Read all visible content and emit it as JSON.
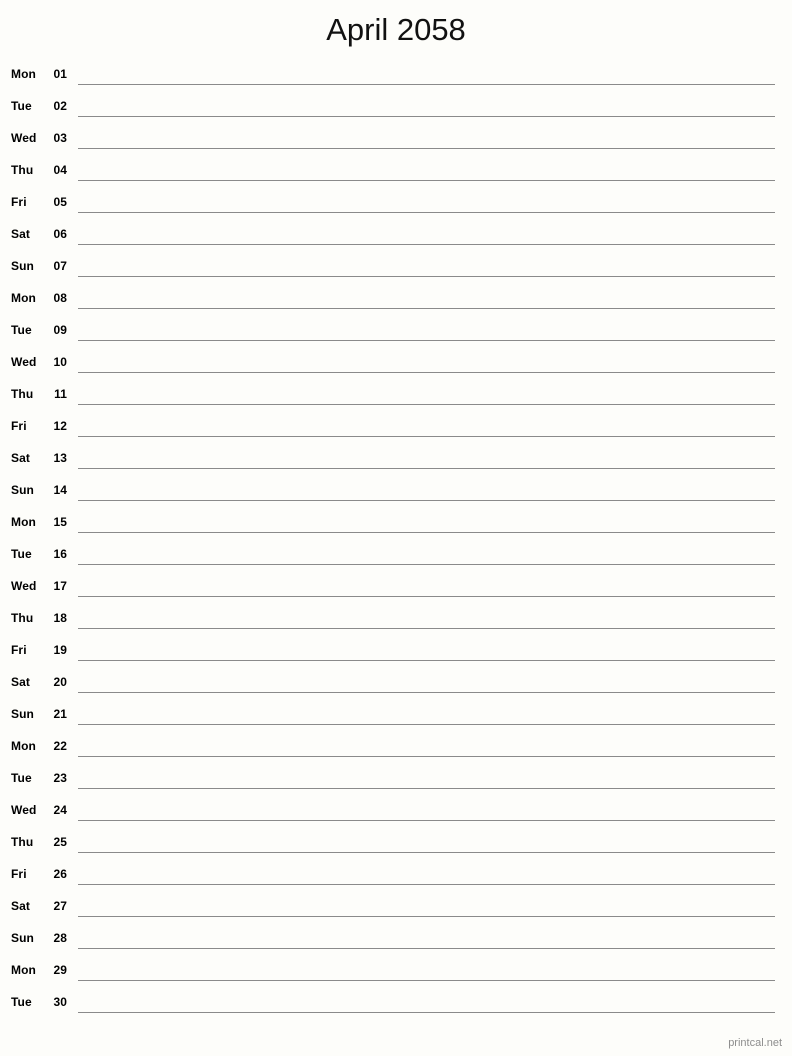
{
  "document": {
    "type": "printable-monthly-calendar",
    "title": "April 2058",
    "month": "April",
    "year": "2058",
    "background_color": "#fdfdfa",
    "rule_color": "#8a8a8a",
    "text_color": "#000000"
  },
  "footer": {
    "label": "printcal.net",
    "color": "#8d8d8d"
  },
  "days": [
    {
      "dow": "Mon",
      "num": "01"
    },
    {
      "dow": "Tue",
      "num": "02"
    },
    {
      "dow": "Wed",
      "num": "03"
    },
    {
      "dow": "Thu",
      "num": "04"
    },
    {
      "dow": "Fri",
      "num": "05"
    },
    {
      "dow": "Sat",
      "num": "06"
    },
    {
      "dow": "Sun",
      "num": "07"
    },
    {
      "dow": "Mon",
      "num": "08"
    },
    {
      "dow": "Tue",
      "num": "09"
    },
    {
      "dow": "Wed",
      "num": "10"
    },
    {
      "dow": "Thu",
      "num": "11"
    },
    {
      "dow": "Fri",
      "num": "12"
    },
    {
      "dow": "Sat",
      "num": "13"
    },
    {
      "dow": "Sun",
      "num": "14"
    },
    {
      "dow": "Mon",
      "num": "15"
    },
    {
      "dow": "Tue",
      "num": "16"
    },
    {
      "dow": "Wed",
      "num": "17"
    },
    {
      "dow": "Thu",
      "num": "18"
    },
    {
      "dow": "Fri",
      "num": "19"
    },
    {
      "dow": "Sat",
      "num": "20"
    },
    {
      "dow": "Sun",
      "num": "21"
    },
    {
      "dow": "Mon",
      "num": "22"
    },
    {
      "dow": "Tue",
      "num": "23"
    },
    {
      "dow": "Wed",
      "num": "24"
    },
    {
      "dow": "Thu",
      "num": "25"
    },
    {
      "dow": "Fri",
      "num": "26"
    },
    {
      "dow": "Sat",
      "num": "27"
    },
    {
      "dow": "Sun",
      "num": "28"
    },
    {
      "dow": "Mon",
      "num": "29"
    },
    {
      "dow": "Tue",
      "num": "30"
    }
  ]
}
